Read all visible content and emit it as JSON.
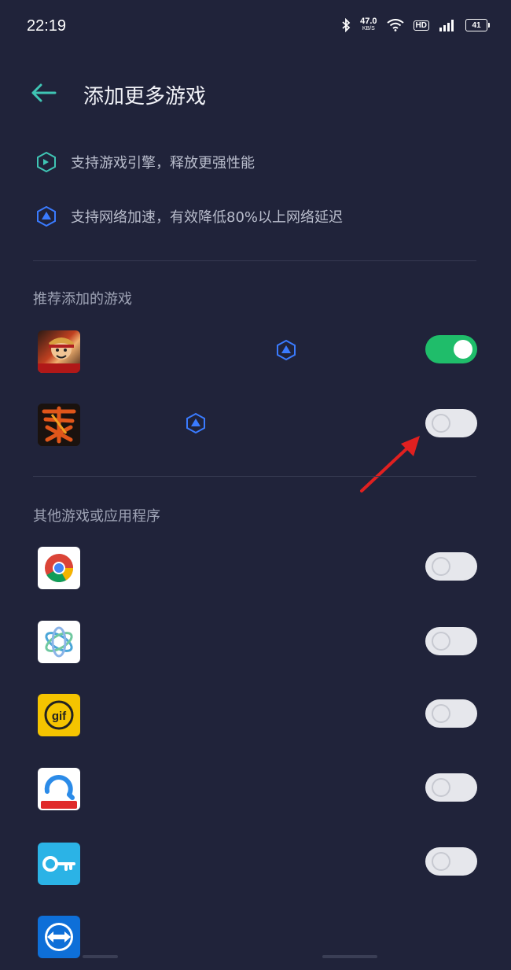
{
  "status_bar": {
    "time": "22:19",
    "net_speed_value": "47.0",
    "net_speed_unit": "KB/S",
    "hd_label": "HD",
    "battery": "41"
  },
  "header": {
    "title": "添加更多游戏"
  },
  "features": [
    {
      "icon": "game-engine-icon",
      "text": "支持游戏引擎，释放更强性能"
    },
    {
      "icon": "network-accel-icon",
      "text": "支持网络加速，有效降低80%以上网络延迟"
    }
  ],
  "sections": {
    "recommended": "推荐添加的游戏",
    "others": "其他游戏或应用程序"
  },
  "recommended_apps": [
    {
      "icon": "one-piece-game-icon",
      "network_accel": true,
      "enabled": true
    },
    {
      "icon": "sanguosha-game-icon",
      "network_accel": true,
      "enabled": false
    }
  ],
  "other_apps": [
    {
      "icon": "chrome-icon",
      "enabled": false
    },
    {
      "icon": "swirl-app-icon",
      "enabled": false
    },
    {
      "icon": "gif-app-icon",
      "enabled": false
    },
    {
      "icon": "browser-app-icon",
      "enabled": false
    },
    {
      "icon": "key-app-icon",
      "enabled": false
    },
    {
      "icon": "teamviewer-icon",
      "enabled": false
    }
  ],
  "colors": {
    "background": "#20233a",
    "toggle_on": "#1fbd6a",
    "toggle_off": "#e6e7ec",
    "accent_teal": "#3fc5b4",
    "accent_blue": "#3a7bff",
    "annotation_arrow": "#e02020"
  }
}
